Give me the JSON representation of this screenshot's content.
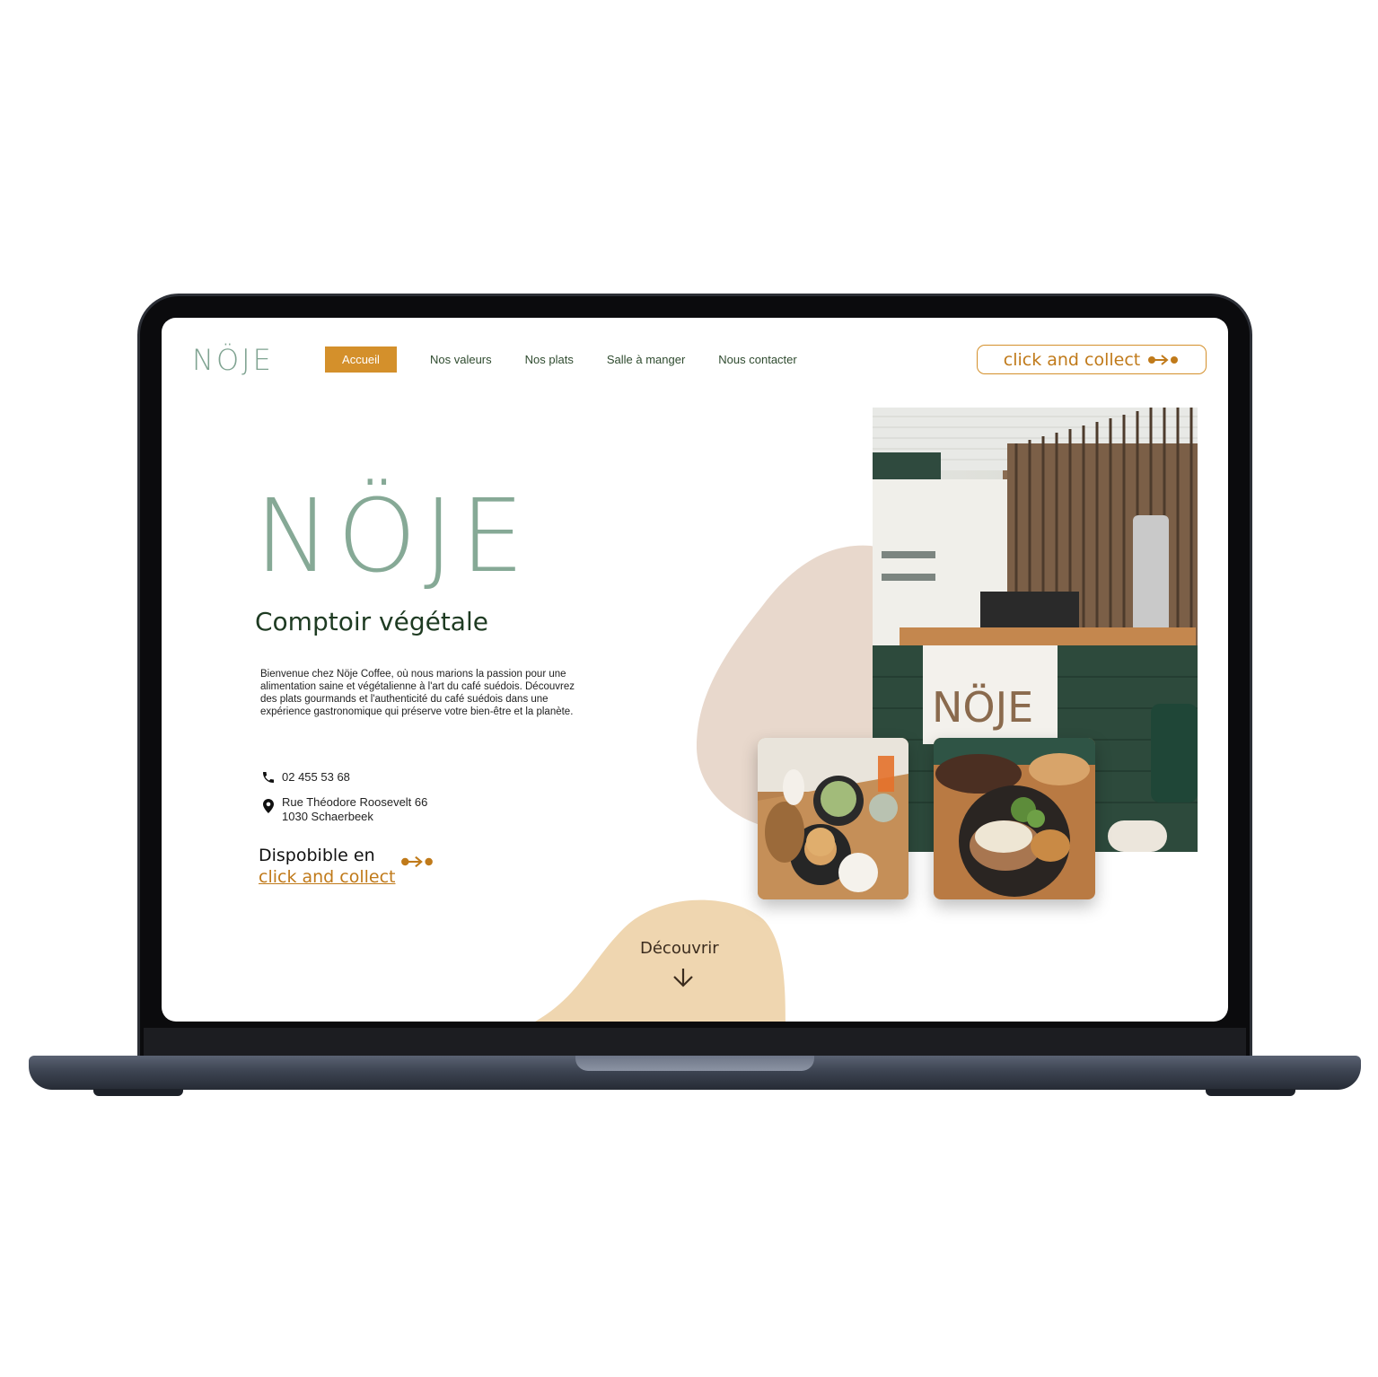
{
  "site": {
    "logo_small": "NÖJE",
    "hero_logo": "NÖJE",
    "tagline": "Comptoir végétale",
    "intro": "Bienvenue chez Nöje Coffee, où nous marions la passion pour une alimentation saine et végétalienne à l'art du café suédois. Découvrez des plats gourmands et l'authenticité du café suédois dans une expérience gastronomique qui préserve votre bien-être et la planète."
  },
  "nav": {
    "items": [
      {
        "label": "Accueil"
      },
      {
        "label": "Nos valeurs"
      },
      {
        "label": "Nos plats"
      },
      {
        "label": "Salle à manger"
      },
      {
        "label": "Nous contacter"
      }
    ],
    "cta": "click and collect"
  },
  "contact": {
    "phone": "02 455 53 68",
    "address_line1": "Rue Théodore Roosevelt 66",
    "address_line2": "1030 Schaerbeek"
  },
  "availability": {
    "label": "Dispobible en",
    "link": "click and collect"
  },
  "discover": "Découvrir",
  "colors": {
    "accent": "#d4902b",
    "accent_text": "#c07a1a",
    "brand_green": "#86a996",
    "dark_green": "#1e3b22",
    "blob_pink": "#e8d8cc",
    "blob_sand": "#efd6b0"
  }
}
